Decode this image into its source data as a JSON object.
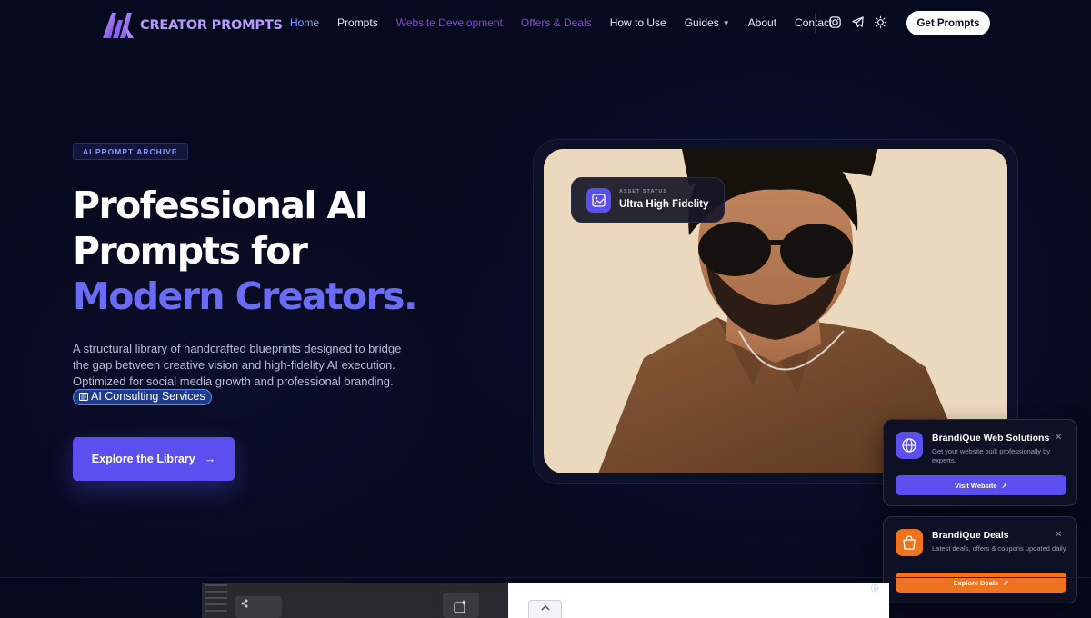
{
  "brand": {
    "name": "CREATOR PROMPTS",
    "accent": "#5b4ff0",
    "orange": "#f07420"
  },
  "nav": {
    "items": [
      {
        "label": "Home"
      },
      {
        "label": "Prompts"
      },
      {
        "label": "Website Development"
      },
      {
        "label": "Offers & Deals"
      },
      {
        "label": "How to Use"
      },
      {
        "label": "Guides"
      },
      {
        "label": "About"
      },
      {
        "label": "Contact"
      }
    ],
    "icons": [
      "instagram-icon",
      "telegram-icon",
      "sun-icon"
    ],
    "cta": "Get Prompts"
  },
  "hero": {
    "badge": "AI PROMPT ARCHIVE",
    "headline_line1": "Professional AI",
    "headline_line2": "Prompts for",
    "headline_accent": "Modern Creators.",
    "description": "A structural library of handcrafted blueprints designed to bridge the gap between creative vision and high-fidelity AI execution. Optimized for social media growth and professional branding.",
    "consult_chip": "AI Consulting Services",
    "cta": "Explore the Library",
    "status_label": "ASSET STATUS",
    "status_value": "Ultra High Fidelity"
  },
  "popups": {
    "web": {
      "title": "BrandiQue Web Solutions",
      "desc": "Get your website built professionally by experts.",
      "button": "Visit Website"
    },
    "deals": {
      "title": "BrandiQue Deals",
      "desc": "Latest deals, offers & coupons updated daily.",
      "button": "Explore Deals"
    }
  }
}
